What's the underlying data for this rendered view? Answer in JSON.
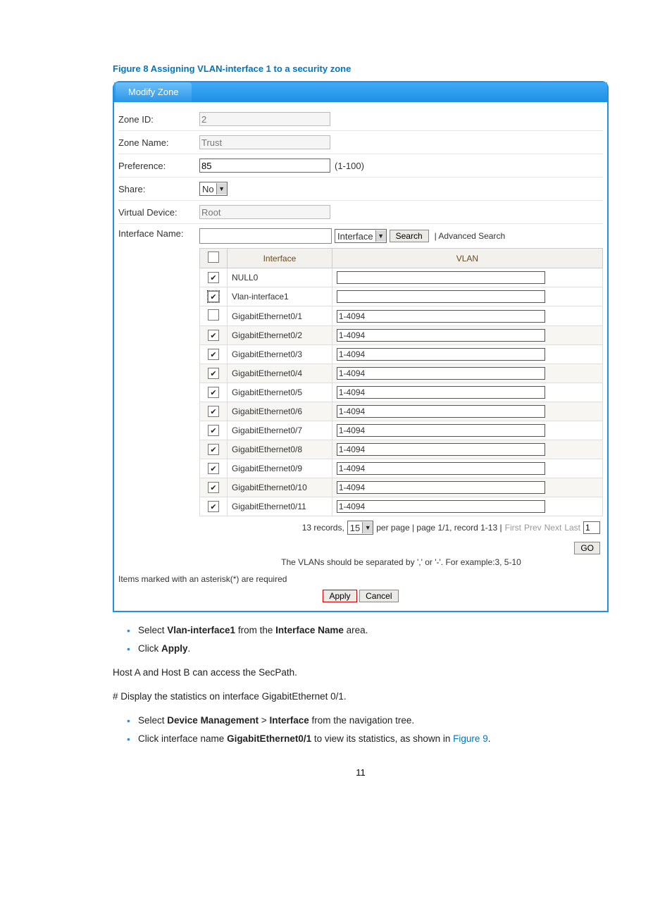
{
  "caption": "Figure 8 Assigning VLAN-interface 1 to a security zone",
  "tab_label": "Modify Zone",
  "form": {
    "zone_id": {
      "label": "Zone ID:",
      "value": "2"
    },
    "zone_name": {
      "label": "Zone Name:",
      "value": "Trust"
    },
    "preference": {
      "label": "Preference:",
      "value": "85",
      "hint": "(1-100)"
    },
    "share": {
      "label": "Share:",
      "value": "No"
    },
    "virtual_device": {
      "label": "Virtual Device:",
      "value": "Root"
    },
    "interface_name_label": "Interface Name:"
  },
  "search": {
    "dropdown": "Interface",
    "button": "Search",
    "advanced": "| Advanced Search"
  },
  "table": {
    "headers": {
      "checkbox": " ",
      "interface": "Interface",
      "vlan": "VLAN"
    },
    "rows": [
      {
        "checked": true,
        "name": "NULL0",
        "vlan": ""
      },
      {
        "checked": true,
        "name": "Vlan-interface1",
        "vlan": "",
        "focus": true
      },
      {
        "checked": false,
        "name": "GigabitEthernet0/1",
        "vlan": "1-4094"
      },
      {
        "checked": true,
        "name": "GigabitEthernet0/2",
        "vlan": "1-4094",
        "alt": true
      },
      {
        "checked": true,
        "name": "GigabitEthernet0/3",
        "vlan": "1-4094"
      },
      {
        "checked": true,
        "name": "GigabitEthernet0/4",
        "vlan": "1-4094",
        "alt": true
      },
      {
        "checked": true,
        "name": "GigabitEthernet0/5",
        "vlan": "1-4094"
      },
      {
        "checked": true,
        "name": "GigabitEthernet0/6",
        "vlan": "1-4094",
        "alt": true
      },
      {
        "checked": true,
        "name": "GigabitEthernet0/7",
        "vlan": "1-4094"
      },
      {
        "checked": true,
        "name": "GigabitEthernet0/8",
        "vlan": "1-4094",
        "alt": true
      },
      {
        "checked": true,
        "name": "GigabitEthernet0/9",
        "vlan": "1-4094"
      },
      {
        "checked": true,
        "name": "GigabitEthernet0/10",
        "vlan": "1-4094",
        "alt": true
      },
      {
        "checked": true,
        "name": "GigabitEthernet0/11",
        "vlan": "1-4094"
      }
    ]
  },
  "pager": {
    "records_prefix": "13 records,",
    "per_page_value": "15",
    "per_page_text": "per page | page 1/1, record 1-13 |",
    "first": "First",
    "prev": "Prev",
    "next": "Next",
    "last": "Last",
    "page_value": "1",
    "go": "GO"
  },
  "helper": "The VLANs should be separated by ',' or '-'. For example:3, 5-10",
  "required_note": "Items marked with an asterisk(*) are required",
  "buttons": {
    "apply": "Apply",
    "cancel": "Cancel"
  },
  "body": {
    "bullet1_a": "Select ",
    "bullet1_b": "Vlan-interface1",
    "bullet1_c": " from the ",
    "bullet1_d": "Interface Name",
    "bullet1_e": " area.",
    "bullet2_a": "Click ",
    "bullet2_b": "Apply",
    "bullet2_c": ".",
    "para1": "Host A and Host B can access the SecPath.",
    "para2": "# Display the statistics on interface GigabitEthernet 0/1.",
    "bullet3_a": "Select ",
    "bullet3_b": "Device Management",
    "bullet3_c": " > ",
    "bullet3_d": "Interface",
    "bullet3_e": " from the navigation tree.",
    "bullet4_a": "Click interface name ",
    "bullet4_b": "GigabitEthernet0/1",
    "bullet4_c": " to view its statistics, as shown in ",
    "bullet4_d": "Figure 9",
    "bullet4_e": "."
  },
  "page_number": "11"
}
